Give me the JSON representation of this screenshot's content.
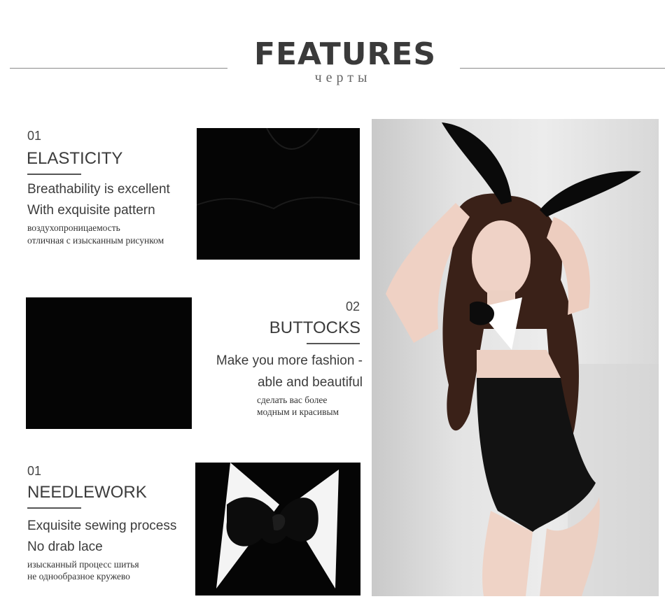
{
  "header": {
    "title": "FEATURES",
    "subtitle": "черты"
  },
  "features": [
    {
      "number": "01",
      "heading": "ELASTICITY",
      "lines_en": [
        "Breathability is excellent",
        "With exquisite pattern"
      ],
      "lines_ru": [
        "воздухопроницаемость",
        "отличная с изысканным рисунком"
      ]
    },
    {
      "number": "02",
      "heading": "BUTTOCKS",
      "lines_en": [
        "Make you more fashion -",
        "able and beautiful"
      ],
      "lines_ru": [
        "сделать вас более",
        "модным  и красивым"
      ]
    },
    {
      "number": "01",
      "heading": "NEEDLEWORK",
      "lines_en": [
        "Exquisite sewing process",
        "No drab lace"
      ],
      "lines_ru": [
        "изысканный процесс шитья",
        "не однообразное кружево"
      ]
    }
  ],
  "colors": {
    "fabric": "#050505",
    "text": "#3c3c3c",
    "rule": "#8a8a8a"
  }
}
